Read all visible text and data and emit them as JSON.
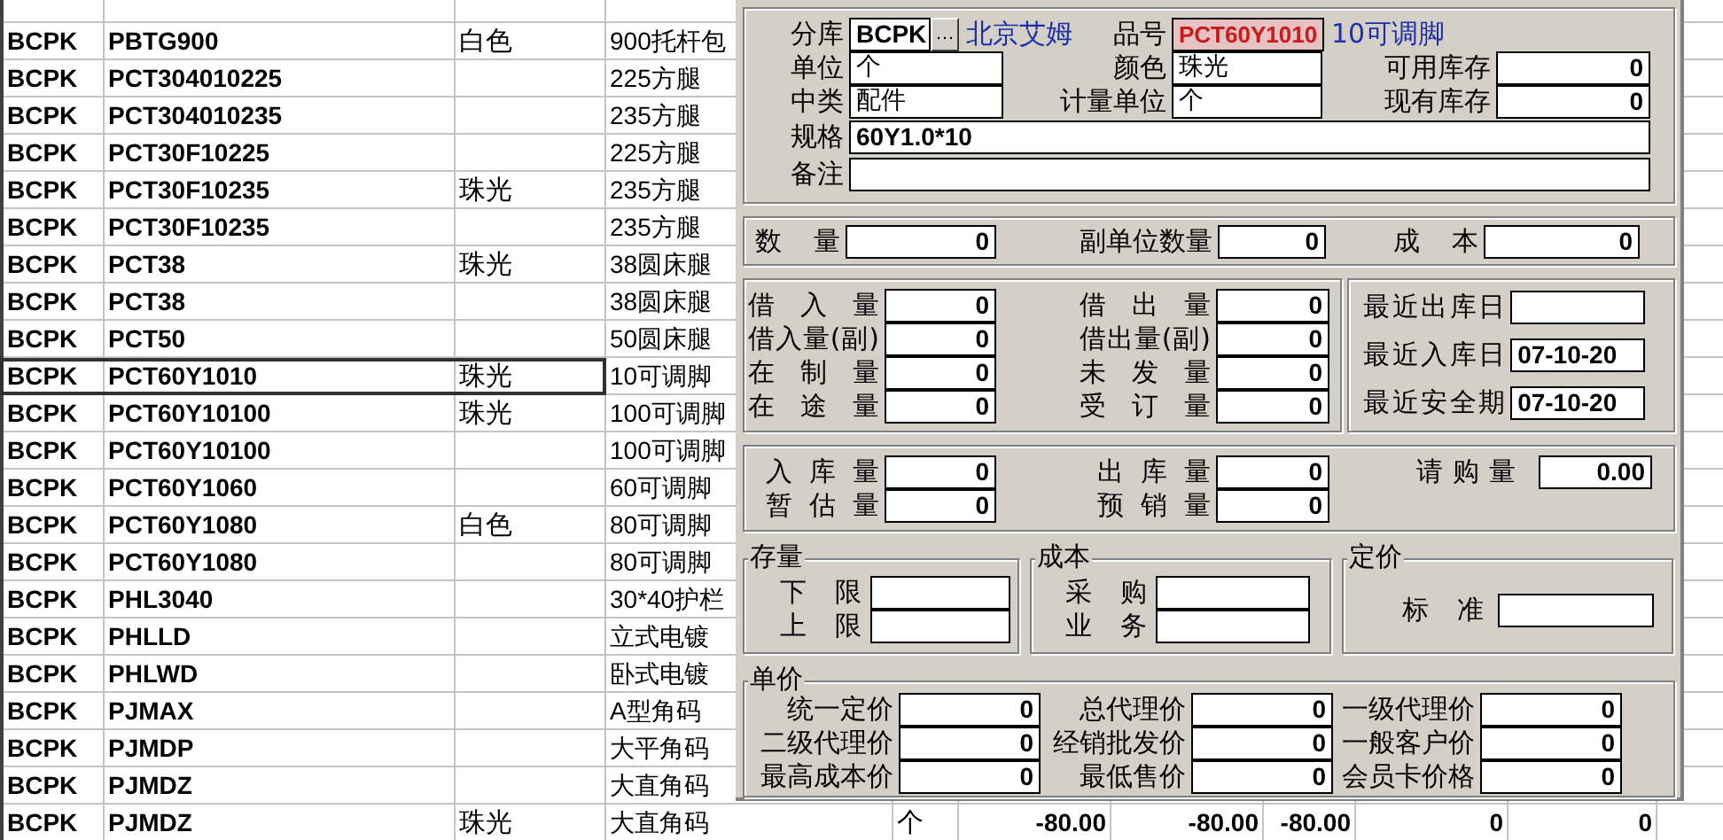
{
  "sheet": {
    "rows": [
      {
        "cells": {
          "col_1": "BCPK",
          "col_2": "PBTG900",
          "col_3": "白色",
          "col_4": "900托杆包"
        },
        "selected": false
      },
      {
        "cells": {
          "col_1": "BCPK",
          "col_2": "PCT304010225",
          "col_4": "225方腿"
        },
        "selected": false
      },
      {
        "cells": {
          "col_1": "BCPK",
          "col_2": "PCT304010235",
          "col_4": "235方腿"
        },
        "selected": false
      },
      {
        "cells": {
          "col_1": "BCPK",
          "col_2": "PCT30F10225",
          "col_4": "225方腿"
        },
        "selected": false
      },
      {
        "cells": {
          "col_1": "BCPK",
          "col_2": "PCT30F10235",
          "col_3": "珠光",
          "col_4": "235方腿"
        },
        "selected": false
      },
      {
        "cells": {
          "col_1": "BCPK",
          "col_2": "PCT30F10235",
          "col_4": "235方腿"
        },
        "selected": false
      },
      {
        "cells": {
          "col_1": "BCPK",
          "col_2": "PCT38",
          "col_3": "珠光",
          "col_4": "38圆床腿"
        },
        "selected": false
      },
      {
        "cells": {
          "col_1": "BCPK",
          "col_2": "PCT38",
          "col_4": "38圆床腿"
        },
        "selected": false
      },
      {
        "cells": {
          "col_1": "BCPK",
          "col_2": "PCT50",
          "col_4": "50圆床腿"
        },
        "selected": false
      },
      {
        "cells": {
          "col_1": "BCPK",
          "col_2": "PCT60Y1010",
          "col_3": "珠光",
          "col_4": "10可调脚"
        },
        "selected": true
      },
      {
        "cells": {
          "col_1": "BCPK",
          "col_2": "PCT60Y10100",
          "col_3": "珠光",
          "col_4": "100可调脚"
        },
        "selected": false
      },
      {
        "cells": {
          "col_1": "BCPK",
          "col_2": "PCT60Y10100",
          "col_4": "100可调脚"
        },
        "selected": false
      },
      {
        "cells": {
          "col_1": "BCPK",
          "col_2": "PCT60Y1060",
          "col_4": "60可调脚"
        },
        "selected": false
      },
      {
        "cells": {
          "col_1": "BCPK",
          "col_2": "PCT60Y1080",
          "col_3": "白色",
          "col_4": "80可调脚"
        },
        "selected": false
      },
      {
        "cells": {
          "col_1": "BCPK",
          "col_2": "PCT60Y1080",
          "col_4": "80可调脚"
        },
        "selected": false
      },
      {
        "cells": {
          "col_1": "BCPK",
          "col_2": "PHL3040",
          "col_4": "30*40护栏"
        },
        "selected": false
      },
      {
        "cells": {
          "col_1": "BCPK",
          "col_2": "PHLLD",
          "col_4": "立式电镀"
        },
        "selected": false
      },
      {
        "cells": {
          "col_1": "BCPK",
          "col_2": "PHLWD",
          "col_4": "卧式电镀"
        },
        "selected": false
      },
      {
        "cells": {
          "col_1": "BCPK",
          "col_2": "PJMAX",
          "col_4": "A型角码"
        },
        "selected": false
      },
      {
        "cells": {
          "col_1": "BCPK",
          "col_2": "PJMDP",
          "col_4": "大平角码"
        },
        "selected": false
      },
      {
        "cells": {
          "col_1": "BCPK",
          "col_2": "PJMDZ",
          "col_4": "大直角码"
        },
        "selected": false
      },
      {
        "cells": {
          "col_1": "BCPK",
          "col_2": "PJMDZ",
          "col_3": "珠光",
          "col_4": "大直角码",
          "col_5": "个",
          "col_6": "-80.00",
          "col_7": "-80.00",
          "col_8": "-80.00",
          "col_9": "0",
          "col_10": "0"
        },
        "selected": false
      }
    ]
  },
  "dialog": {
    "header": {
      "branch": {
        "label": "分库",
        "value": "BCPK",
        "button": "…",
        "name": "北京艾姆"
      },
      "item": {
        "label": "品号",
        "value": "PCT60Y1010",
        "highlighted": true,
        "description": "10可调脚"
      },
      "unit": {
        "label": "单位",
        "value": "个"
      },
      "color": {
        "label": "颜色",
        "value": "珠光"
      },
      "available_stock": {
        "label": "可用库存",
        "value": "0"
      },
      "category": {
        "label": "中类",
        "value": "配件"
      },
      "measure_unit": {
        "label": "计量单位",
        "value": "个"
      },
      "current_stock": {
        "label": "现有库存",
        "value": "0"
      },
      "spec": {
        "label": "规格",
        "value": "60Y1.0*10"
      },
      "remark": {
        "label": "备注"
      }
    },
    "quantity_row": [
      {
        "label": "数 量",
        "value": "0"
      },
      {
        "label": "副单位数量",
        "value": "0"
      },
      {
        "label": "成 本",
        "value": "0"
      }
    ],
    "borrow_left": [
      {
        "label": "借 入 量",
        "value": "0"
      },
      {
        "label": "借入量(副)",
        "value": "0"
      },
      {
        "label": "在 制 量",
        "value": "0"
      },
      {
        "label": "在 途 量",
        "value": "0"
      }
    ],
    "borrow_right": [
      {
        "label": "借 出 量",
        "value": "0"
      },
      {
        "label": "借出量(副)",
        "value": "0"
      },
      {
        "label": "未 发 量",
        "value": "0"
      },
      {
        "label": "受 订 量",
        "value": "0"
      }
    ],
    "dates": [
      {
        "label": "最近出库日"
      },
      {
        "label": "最近入库日",
        "value": "07-10-20"
      },
      {
        "label": "最近安全期",
        "value": "07-10-20"
      }
    ],
    "stock_in": [
      {
        "label": "入 库 量",
        "value": "0"
      },
      {
        "label": "暂 估 量",
        "value": "0"
      }
    ],
    "stock_out": [
      {
        "label": "出 库 量",
        "value": "0"
      },
      {
        "label": "预 销 量",
        "value": "0"
      }
    ],
    "purchase": {
      "label": "请 购 量",
      "value": "0.00"
    },
    "groups": [
      {
        "title": "存量",
        "fields": [
          {
            "label": "下 限"
          },
          {
            "label": "上 限"
          }
        ]
      },
      {
        "title": "成本",
        "fields": [
          {
            "label": "采 购"
          },
          {
            "label": "业 务"
          }
        ]
      },
      {
        "title": "定价",
        "fields": [
          {
            "label": "标 准"
          }
        ]
      }
    ],
    "prices": {
      "title": "单价",
      "columns": [
        {
          "fields": [
            {
              "label": "统一定价",
              "value": "0"
            },
            {
              "label": "二级代理价",
              "value": "0"
            },
            {
              "label": "最高成本价",
              "value": "0"
            }
          ]
        },
        {
          "fields": [
            {
              "label": "总代理价",
              "value": "0"
            },
            {
              "label": "经销批发价",
              "value": "0"
            },
            {
              "label": "最低售价",
              "value": "0"
            }
          ]
        },
        {
          "fields": [
            {
              "label": "一级代理价",
              "value": "0"
            },
            {
              "label": "一般客户价",
              "value": "0"
            },
            {
              "label": "会员卡价格",
              "value": "0"
            }
          ]
        }
      ]
    }
  }
}
